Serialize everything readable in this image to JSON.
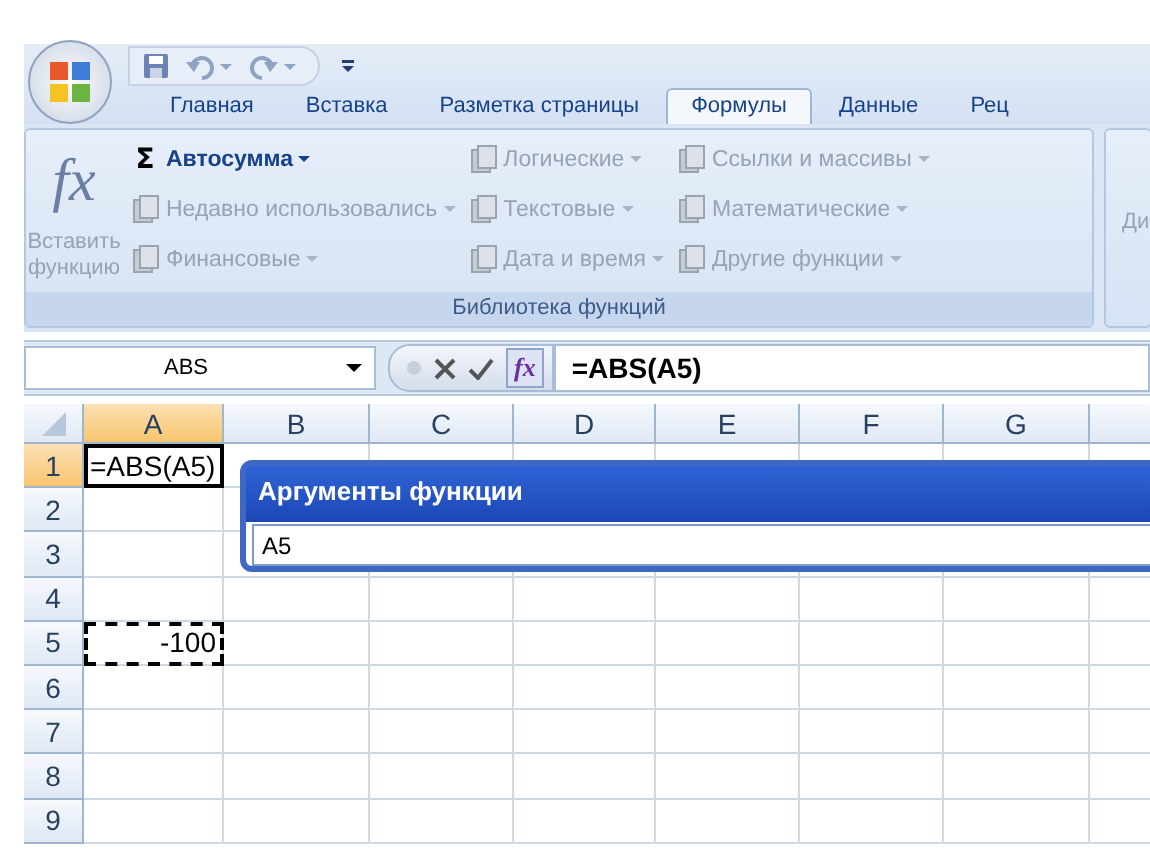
{
  "tabs": [
    {
      "label": "Главная",
      "selected": false
    },
    {
      "label": "Вставка",
      "selected": false
    },
    {
      "label": "Разметка страницы",
      "selected": false
    },
    {
      "label": "Формулы",
      "selected": true
    },
    {
      "label": "Данные",
      "selected": false
    },
    {
      "label": "Рец",
      "selected": false
    }
  ],
  "ribbon": {
    "group_label": "Библиотека функций",
    "large_button": {
      "icon_text": "fx",
      "label": "Вставить функцию",
      "disabled": true
    },
    "columns": [
      [
        {
          "icon_text": "Σ",
          "label": "Автосумма",
          "disabled": false
        },
        {
          "label": "Недавно использовались",
          "disabled": true
        },
        {
          "label": "Финансовые",
          "disabled": true
        }
      ],
      [
        {
          "label": "Логические",
          "disabled": true
        },
        {
          "label": "Текстовые",
          "disabled": true
        },
        {
          "label": "Дата и время",
          "disabled": true
        }
      ],
      [
        {
          "label": "Ссылки и массивы",
          "disabled": true
        },
        {
          "label": "Математические",
          "disabled": true
        },
        {
          "label": "Другие функции",
          "disabled": true
        }
      ]
    ],
    "next_group_button": {
      "label": "Ди",
      "disabled": true
    }
  },
  "formula_bar": {
    "name_box": "ABS",
    "fx_text": "fx",
    "formula": "=ABS(A5)"
  },
  "grid": {
    "columns": [
      {
        "label": "A",
        "selected": true
      },
      {
        "label": "B",
        "selected": false
      },
      {
        "label": "C",
        "selected": false
      },
      {
        "label": "D",
        "selected": false
      },
      {
        "label": "E",
        "selected": false
      },
      {
        "label": "F",
        "selected": false
      },
      {
        "label": "G",
        "selected": false
      }
    ],
    "rows": [
      {
        "label": "1",
        "selected": true,
        "cells": [
          {
            "value": "=ABS(A5)",
            "kind": "active"
          }
        ]
      },
      {
        "label": "2",
        "selected": false,
        "cells": []
      },
      {
        "label": "3",
        "selected": false,
        "cells": []
      },
      {
        "label": "4",
        "selected": false,
        "cells": []
      },
      {
        "label": "5",
        "selected": false,
        "cells": [
          {
            "value": "-100",
            "kind": "marquee"
          }
        ]
      },
      {
        "label": "6",
        "selected": false,
        "cells": []
      },
      {
        "label": "7",
        "selected": false,
        "cells": []
      },
      {
        "label": "8",
        "selected": false,
        "cells": []
      },
      {
        "label": "9",
        "selected": false,
        "cells": []
      }
    ]
  },
  "dialog": {
    "title": "Аргументы функции",
    "field_value": "A5"
  }
}
